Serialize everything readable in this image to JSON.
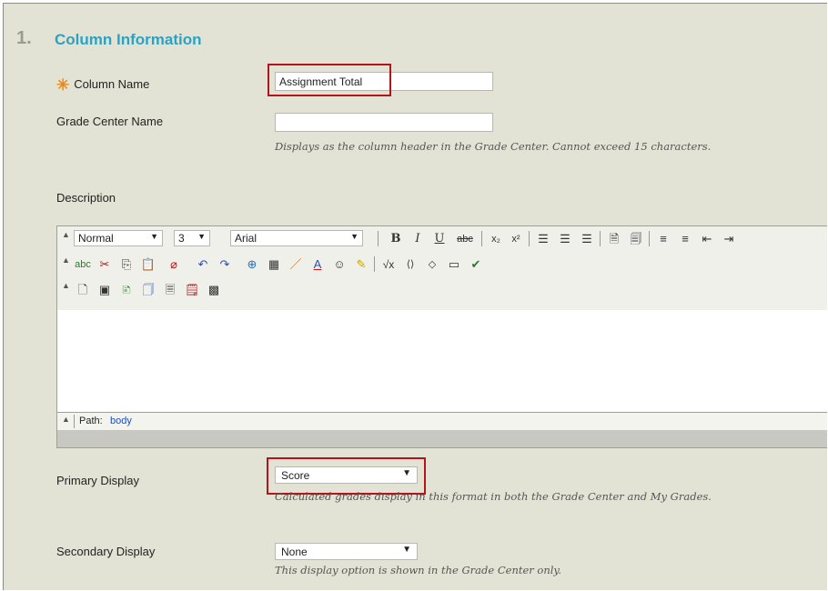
{
  "section": {
    "number": "1.",
    "title": "Column Information"
  },
  "fields": {
    "column_name": {
      "label": "Column Name",
      "value": "Assignment Total"
    },
    "grade_center_name": {
      "label": "Grade Center Name",
      "value": "",
      "hint": "Displays as the column header in the Grade Center. Cannot exceed 15 characters."
    },
    "description": {
      "label": "Description"
    }
  },
  "editor": {
    "format": "Normal",
    "size": "3",
    "font": "Arial",
    "path_label": "Path:",
    "path_value": "body"
  },
  "primary_display": {
    "label": "Primary Display",
    "value": "Score",
    "hint": "Calculated grades display in this format in both the Grade Center and My Grades."
  },
  "secondary_display": {
    "label": "Secondary Display",
    "value": "None",
    "hint": "This display option is shown in the Grade Center only."
  },
  "colors": {
    "accent": "#2aa3c3",
    "required": "#e88a1a",
    "highlight": "#b3141a",
    "panel": "#e3e3d5"
  }
}
